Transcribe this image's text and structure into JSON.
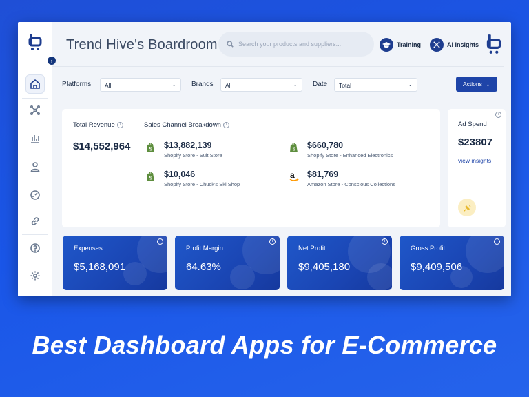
{
  "app": {
    "title": "Trend Hive's Boardroom",
    "search": {
      "placeholder": "Search your products and suppliers..."
    },
    "top_buttons": {
      "training": "Training",
      "ai_insights": "AI Insights"
    },
    "sidebar": {
      "items": [
        {
          "icon": "home-icon",
          "active": true
        },
        {
          "icon": "network-icon",
          "active": false
        },
        {
          "icon": "bar-chart-icon",
          "active": false
        },
        {
          "icon": "user-icon",
          "active": false
        },
        {
          "icon": "gauge-icon",
          "active": false
        },
        {
          "icon": "link-icon",
          "active": false
        },
        {
          "icon": "help-icon",
          "active": false
        },
        {
          "icon": "gear-icon",
          "active": false
        }
      ]
    },
    "filters": {
      "platforms": {
        "label": "Platforms",
        "value": "All"
      },
      "brands": {
        "label": "Brands",
        "value": "All"
      },
      "date": {
        "label": "Date",
        "value": "Total"
      },
      "actions": "Actions"
    },
    "revenue": {
      "label": "Total Revenue",
      "value": "$14,552,964",
      "breakdown_label": "Sales Channel Breakdown",
      "channels": [
        {
          "value": "$13,882,139",
          "name": "Shopify Store - Suit Store",
          "icon": "shopify-icon"
        },
        {
          "value": "$660,780",
          "name": "Shopify Store - Enhanced Electronics",
          "icon": "shopify-icon"
        },
        {
          "value": "$10,046",
          "name": "Shopify Store - Chuck's Ski Shop",
          "icon": "shopify-icon"
        },
        {
          "value": "$81,769",
          "name": "Amazon Store - Conscious Collections",
          "icon": "amazon-icon"
        }
      ]
    },
    "ad_spend": {
      "label": "Ad Spend",
      "value": "$23807",
      "link": "view insights"
    },
    "kpis": [
      {
        "title": "Expenses",
        "value": "$5,168,091"
      },
      {
        "title": "Profit Margin",
        "value": "64.63%"
      },
      {
        "title": "Net Profit",
        "value": "$9,405,180"
      },
      {
        "title": "Gross Profit",
        "value": "$9,409,506"
      }
    ],
    "colors": {
      "brand": "#1e3d8f",
      "accent": "#1e44a8",
      "kpi": "#1a45b3",
      "shopify": "#5e8e3e",
      "amazon_arrow": "#ff9900"
    }
  },
  "headline": "Best Dashboard Apps for E-Commerce"
}
